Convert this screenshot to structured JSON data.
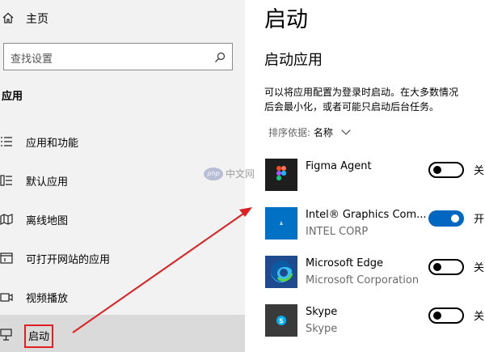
{
  "sidebar": {
    "home_label": "主页",
    "search_placeholder": "查找设置",
    "section_title": "应用",
    "items": [
      {
        "label": "应用和功能",
        "icon": "apps-list-icon"
      },
      {
        "label": "默认应用",
        "icon": "default-apps-icon"
      },
      {
        "label": "离线地图",
        "icon": "offline-maps-icon"
      },
      {
        "label": "可打开网站的应用",
        "icon": "apps-for-websites-icon"
      },
      {
        "label": "视频播放",
        "icon": "video-playback-icon"
      },
      {
        "label": "启动",
        "icon": "startup-icon",
        "active": true
      }
    ]
  },
  "main": {
    "title": "启动",
    "subheading": "启动应用",
    "description_line1": "可以将应用配置为登录时启动。在大多数情况",
    "description_line2": "后会最小化，或者可能只启动后台任务。",
    "sort_label": "排序依据:",
    "sort_value": "名称",
    "apps": [
      {
        "name": "Figma Agent",
        "publisher": "",
        "enabled": false,
        "state_label": "关",
        "icon": "figma-icon",
        "icon_bg": "#1e1e1e"
      },
      {
        "name": "Intel® Graphics Com...",
        "publisher": "INTEL CORP",
        "enabled": true,
        "state_label": "开",
        "icon": "intel-graphics-icon",
        "icon_bg": "#0071c5"
      },
      {
        "name": "Microsoft Edge",
        "publisher": "Microsoft Corporation",
        "enabled": false,
        "state_label": "关",
        "icon": "edge-icon",
        "icon_bg": "#1f4b8e"
      },
      {
        "name": "Skype",
        "publisher": "Skype",
        "enabled": false,
        "state_label": "关",
        "icon": "skype-icon",
        "icon_bg": "#3a3a3a"
      }
    ]
  },
  "watermark": {
    "text": "中文网",
    "logo": "php"
  },
  "colors": {
    "accent": "#0067c0",
    "annotation": "#e02020",
    "sidebar_bg": "#f2f2f2",
    "active_bg": "#dadada"
  }
}
